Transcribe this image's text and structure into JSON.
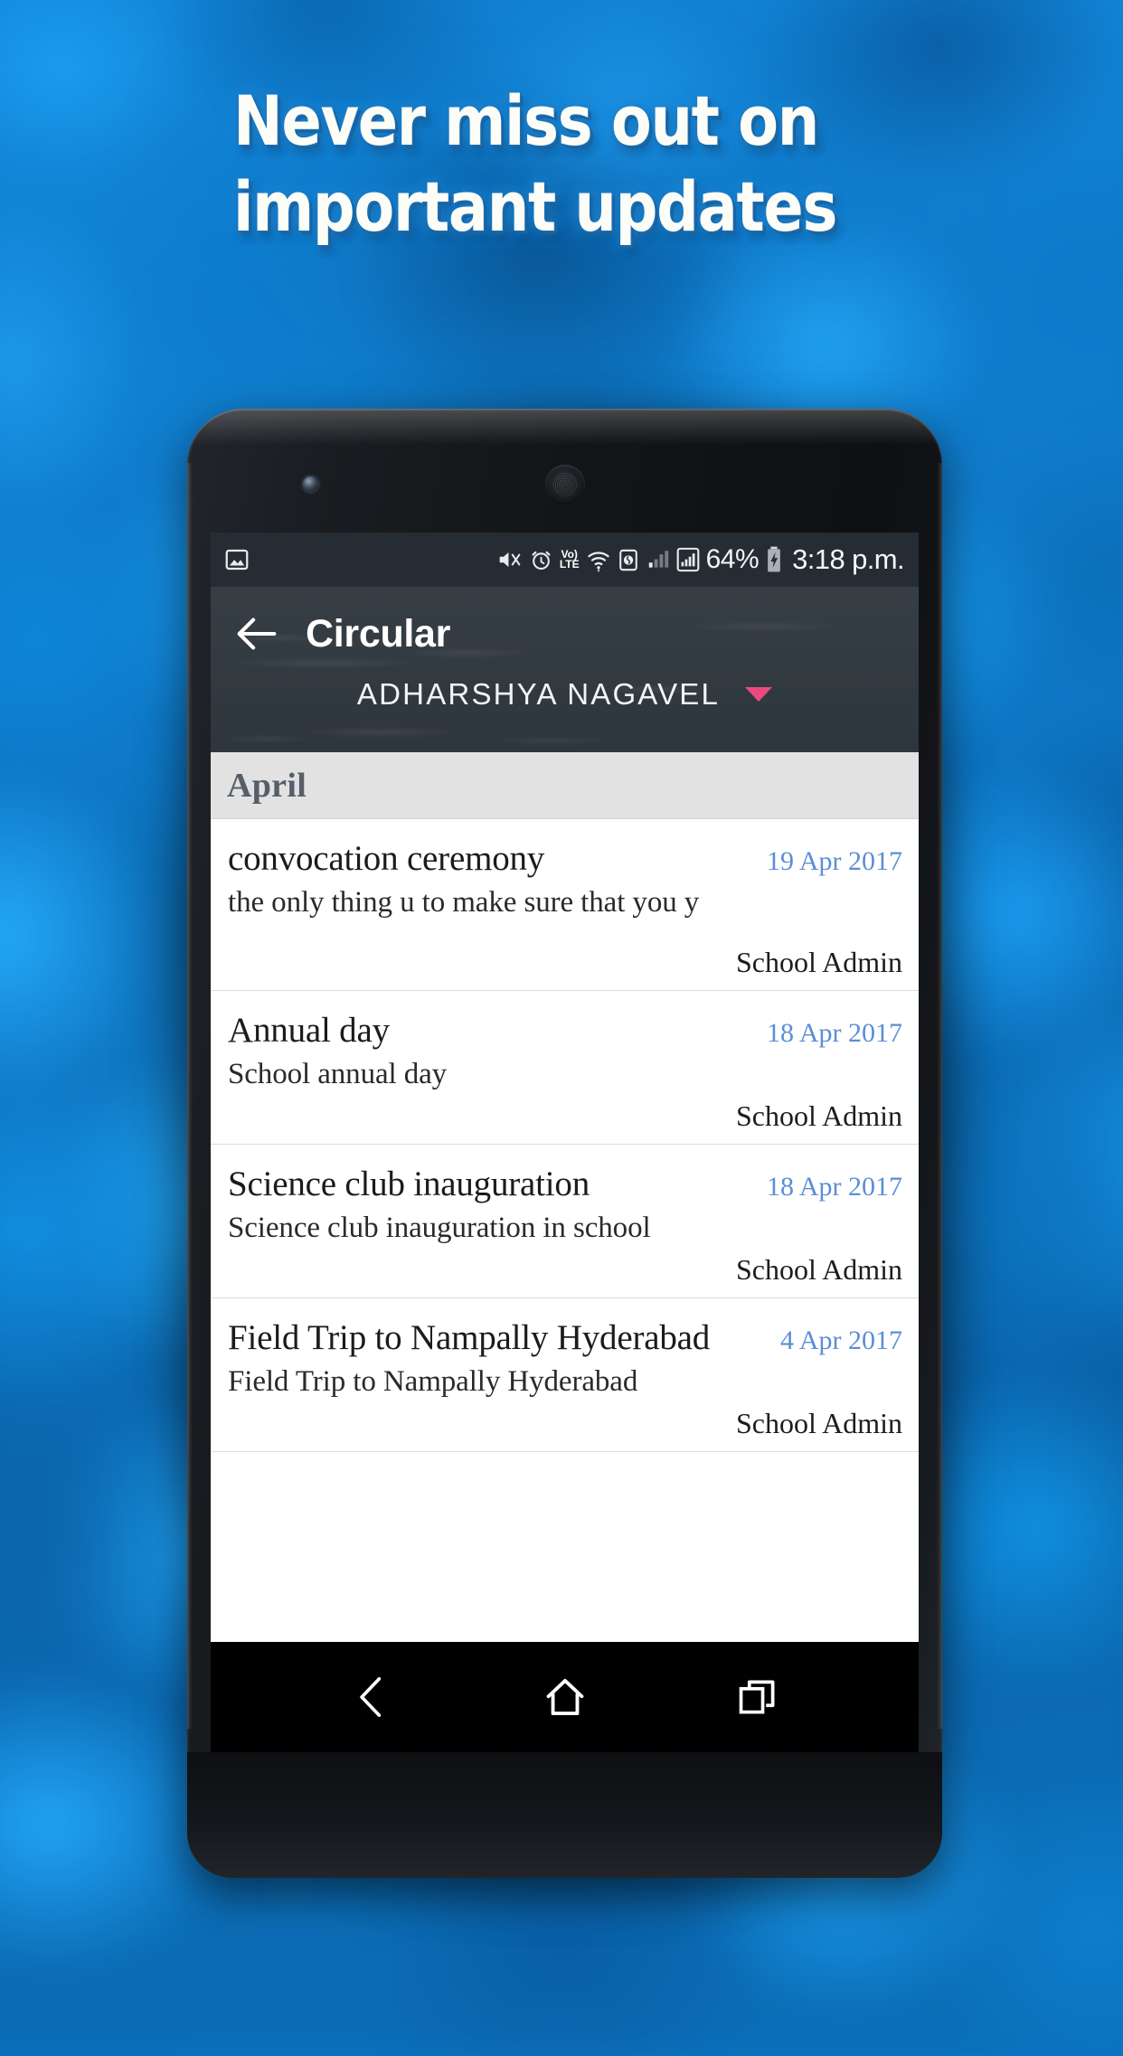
{
  "promo": {
    "headline_lines": [
      "Never miss out on",
      "important updates"
    ],
    "text_color": "#fdfdf8",
    "glow_color": "#1a7ec9",
    "background_color": "#0d76c4"
  },
  "status_bar": {
    "left_icons": [
      "screenshot-image-icon"
    ],
    "right_icons": [
      "volume-mute-icon",
      "alarm-clock-icon",
      "volte-icon",
      "wifi-icon",
      "sim-data-icon",
      "signal-bars-weak-icon",
      "signal-bars-full-icon"
    ],
    "volte_label_top": "Vo)",
    "volte_label_bottom": "LTE",
    "battery_percent": "64%",
    "battery_state": "charging",
    "clock": "3:18 p.m.",
    "background_color": "#262c33"
  },
  "app_bar": {
    "back_icon": "back-arrow-icon",
    "title": "Circular",
    "student_name": "ADHARSHYA  NAGAVEL",
    "student_caret_icon": "dropdown-caret-icon",
    "caret_color": "#ec4a7f",
    "background_color": "#30383f"
  },
  "month_section": {
    "label": "April",
    "background_color": "#e2e2e2",
    "text_color": "#565f68"
  },
  "circulars": [
    {
      "title": "convocation ceremony",
      "date": "19 Apr 2017",
      "description": "the only thing u to make sure that you y",
      "author": "School Admin"
    },
    {
      "title": "Annual day",
      "date": "18 Apr 2017",
      "description": "School annual day",
      "author": "School Admin"
    },
    {
      "title": "Science club inauguration",
      "date": "18 Apr 2017",
      "description": "Science club inauguration in school",
      "author": "School Admin"
    },
    {
      "title": "Field Trip to Nampally Hyderabad",
      "date": "4 Apr 2017",
      "description": "Field Trip to Nampally Hyderabad",
      "author": "School Admin"
    }
  ],
  "date_color": "#5b8ed6",
  "nav_bar": {
    "back_icon": "nav-back-chevron-icon",
    "home_icon": "nav-home-icon",
    "recents_icon": "nav-recents-icon",
    "background_color": "#000000"
  },
  "device": {
    "earpiece_icon": "earpiece-speaker",
    "camera_icon": "front-camera",
    "volume_button": "volume-rocker",
    "power_button": "power-button"
  }
}
